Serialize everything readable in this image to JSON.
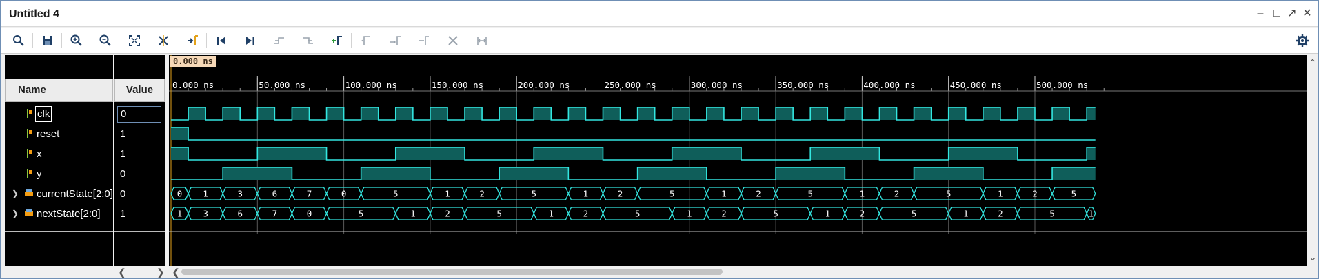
{
  "window": {
    "title": "Untitled 4"
  },
  "toolbar": {
    "tools": [
      {
        "name": "search-button",
        "icon": "search-icon"
      },
      {
        "name": "save-button",
        "icon": "save-icon"
      },
      {
        "name": "zoom-in-button",
        "icon": "zoom-in-icon"
      },
      {
        "name": "zoom-out-button",
        "icon": "zoom-out-icon"
      },
      {
        "name": "zoom-fit-button",
        "icon": "zoom-fit-icon"
      },
      {
        "name": "zoom-to-cursor-button",
        "icon": "zoom-cursor-icon"
      },
      {
        "name": "go-to-cursor-button",
        "icon": "goto-cursor-icon"
      },
      {
        "name": "go-to-time-0-button",
        "icon": "go-start-icon"
      },
      {
        "name": "go-to-last-time-button",
        "icon": "go-end-icon"
      },
      {
        "name": "previous-transition-button",
        "icon": "prev-transition-icon"
      },
      {
        "name": "next-transition-button",
        "icon": "next-transition-icon"
      },
      {
        "name": "add-marker-button",
        "icon": "add-marker-icon"
      },
      {
        "name": "previous-marker-button",
        "icon": "prev-marker-icon"
      },
      {
        "name": "next-marker-button",
        "icon": "next-marker-icon"
      },
      {
        "name": "swap-cursors-button",
        "icon": "swap-cursors-icon"
      },
      {
        "name": "delete-markers-button",
        "icon": "delete-icon"
      },
      {
        "name": "snap-to-transition-button",
        "icon": "snap-icon"
      }
    ],
    "settings_icon": "gear-icon"
  },
  "panels": {
    "name_header": "Name",
    "value_header": "Value"
  },
  "cursor": {
    "time_label": "0.000 ns"
  },
  "timeline": {
    "ticks": [
      "0.000 ns",
      "50.000 ns",
      "100.000 ns",
      "150.000 ns",
      "200.000 ns",
      "250.000 ns",
      "300.000 ns",
      "350.000 ns",
      "400.000 ns",
      "450.000 ns",
      "500.000 ns"
    ]
  },
  "signals": [
    {
      "name": "clk",
      "value": "0",
      "type": "bit",
      "selected": true
    },
    {
      "name": "reset",
      "value": "1",
      "type": "bit"
    },
    {
      "name": "x",
      "value": "1",
      "type": "bit"
    },
    {
      "name": "y",
      "value": "0",
      "type": "bit"
    },
    {
      "name": "currentState[2:0]",
      "value": "0",
      "type": "bus",
      "expandable": true
    },
    {
      "name": "nextState[2:0]",
      "value": "1",
      "type": "bus",
      "expandable": true
    }
  ],
  "waveforms": {
    "time_max_ns": 535,
    "clk_period_ns": 20,
    "reset": [
      [
        0,
        10,
        1
      ],
      [
        10,
        535,
        0
      ]
    ],
    "x": [
      [
        0,
        10,
        1
      ],
      [
        10,
        50,
        0
      ],
      [
        50,
        90,
        1
      ],
      [
        90,
        130,
        0
      ],
      [
        130,
        170,
        1
      ],
      [
        170,
        210,
        0
      ],
      [
        210,
        250,
        1
      ],
      [
        250,
        290,
        0
      ],
      [
        290,
        330,
        1
      ],
      [
        330,
        370,
        0
      ],
      [
        370,
        410,
        1
      ],
      [
        410,
        450,
        0
      ],
      [
        450,
        490,
        1
      ],
      [
        490,
        530,
        0
      ],
      [
        530,
        535,
        1
      ]
    ],
    "y": [
      [
        0,
        30,
        0
      ],
      [
        30,
        70,
        1
      ],
      [
        70,
        110,
        0
      ],
      [
        110,
        150,
        1
      ],
      [
        150,
        190,
        0
      ],
      [
        190,
        230,
        1
      ],
      [
        230,
        270,
        0
      ],
      [
        270,
        310,
        1
      ],
      [
        310,
        350,
        0
      ],
      [
        350,
        390,
        1
      ],
      [
        390,
        430,
        0
      ],
      [
        430,
        470,
        1
      ],
      [
        470,
        510,
        0
      ],
      [
        510,
        535,
        1
      ]
    ],
    "currentState": [
      {
        "t0": 0,
        "t1": 10,
        "v": "0"
      },
      {
        "t0": 10,
        "t1": 30,
        "v": "1"
      },
      {
        "t0": 30,
        "t1": 50,
        "v": "3"
      },
      {
        "t0": 50,
        "t1": 70,
        "v": "6"
      },
      {
        "t0": 70,
        "t1": 90,
        "v": "7"
      },
      {
        "t0": 90,
        "t1": 110,
        "v": "0"
      },
      {
        "t0": 110,
        "t1": 150,
        "v": "5"
      },
      {
        "t0": 150,
        "t1": 170,
        "v": "1"
      },
      {
        "t0": 170,
        "t1": 190,
        "v": "2"
      },
      {
        "t0": 190,
        "t1": 230,
        "v": "5"
      },
      {
        "t0": 230,
        "t1": 250,
        "v": "1"
      },
      {
        "t0": 250,
        "t1": 270,
        "v": "2"
      },
      {
        "t0": 270,
        "t1": 310,
        "v": "5"
      },
      {
        "t0": 310,
        "t1": 330,
        "v": "1"
      },
      {
        "t0": 330,
        "t1": 350,
        "v": "2"
      },
      {
        "t0": 350,
        "t1": 390,
        "v": "5"
      },
      {
        "t0": 390,
        "t1": 410,
        "v": "1"
      },
      {
        "t0": 410,
        "t1": 430,
        "v": "2"
      },
      {
        "t0": 430,
        "t1": 470,
        "v": "5"
      },
      {
        "t0": 470,
        "t1": 490,
        "v": "1"
      },
      {
        "t0": 490,
        "t1": 510,
        "v": "2"
      },
      {
        "t0": 510,
        "t1": 535,
        "v": "5"
      }
    ],
    "nextState": [
      {
        "t0": 0,
        "t1": 10,
        "v": "1"
      },
      {
        "t0": 10,
        "t1": 30,
        "v": "3"
      },
      {
        "t0": 30,
        "t1": 50,
        "v": "6"
      },
      {
        "t0": 50,
        "t1": 70,
        "v": "7"
      },
      {
        "t0": 70,
        "t1": 90,
        "v": "0"
      },
      {
        "t0": 90,
        "t1": 130,
        "v": "5"
      },
      {
        "t0": 130,
        "t1": 150,
        "v": "1"
      },
      {
        "t0": 150,
        "t1": 170,
        "v": "2"
      },
      {
        "t0": 170,
        "t1": 210,
        "v": "5"
      },
      {
        "t0": 210,
        "t1": 230,
        "v": "1"
      },
      {
        "t0": 230,
        "t1": 250,
        "v": "2"
      },
      {
        "t0": 250,
        "t1": 290,
        "v": "5"
      },
      {
        "t0": 290,
        "t1": 310,
        "v": "1"
      },
      {
        "t0": 310,
        "t1": 330,
        "v": "2"
      },
      {
        "t0": 330,
        "t1": 370,
        "v": "5"
      },
      {
        "t0": 370,
        "t1": 390,
        "v": "1"
      },
      {
        "t0": 390,
        "t1": 410,
        "v": "2"
      },
      {
        "t0": 410,
        "t1": 450,
        "v": "5"
      },
      {
        "t0": 450,
        "t1": 470,
        "v": "1"
      },
      {
        "t0": 470,
        "t1": 490,
        "v": "2"
      },
      {
        "t0": 490,
        "t1": 530,
        "v": "5"
      },
      {
        "t0": 530,
        "t1": 535,
        "v": "1"
      }
    ]
  },
  "colors": {
    "wave_fill": "#0f5e5a",
    "wave_line": "#33e6e0",
    "grid": "#5a5a5a",
    "tick_text": "#ffffff",
    "background": "#000000"
  }
}
